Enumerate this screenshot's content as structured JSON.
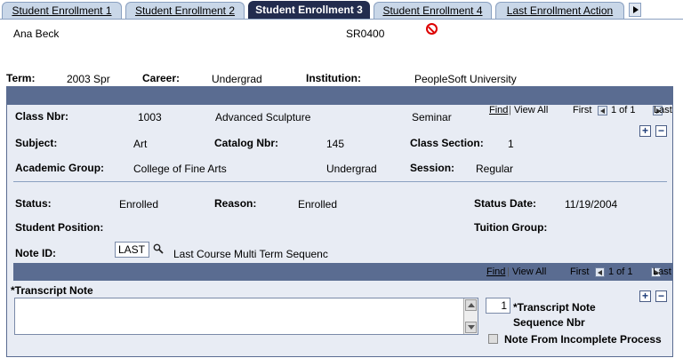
{
  "tabs": [
    {
      "label": "Student Enrollment 1",
      "active": false
    },
    {
      "label": "Student Enrollment 2",
      "active": false
    },
    {
      "label": "Student Enrollment 3",
      "active": true
    },
    {
      "label": "Student Enrollment 4",
      "active": false
    },
    {
      "label": "Last Enrollment Action",
      "active": false
    }
  ],
  "header": {
    "student_name": "Ana Beck",
    "student_id": "SR0400",
    "term_label": "Term:",
    "term_value": "2003 Spr",
    "career_label": "Career:",
    "career_value": "Undergrad",
    "institution_label": "Institution:",
    "institution_value": "PeopleSoft University"
  },
  "outer_nav": {
    "find": "Find",
    "sep": "|",
    "view_all": "View All",
    "first": "First",
    "position": "1 of 1",
    "last": "Last"
  },
  "class": {
    "class_nbr_label": "Class Nbr:",
    "class_nbr_value": "1003",
    "class_title": "Advanced Sculpture",
    "component": "Seminar",
    "subject_label": "Subject:",
    "subject_value": "Art",
    "catalog_label": "Catalog Nbr:",
    "catalog_value": "145",
    "section_label": "Class Section:",
    "section_value": "1",
    "acad_group_label": "Academic Group:",
    "acad_group_value": "College of Fine Arts",
    "acad_career": "Undergrad",
    "session_label": "Session:",
    "session_value": "Regular"
  },
  "status": {
    "status_label": "Status:",
    "status_value": "Enrolled",
    "reason_label": "Reason:",
    "reason_value": "Enrolled",
    "status_date_label": "Status Date:",
    "status_date_value": "11/19/2004",
    "position_label": "Student Position:",
    "tuition_label": "Tuition Group:",
    "note_id_label": "Note ID:",
    "note_id_value": "LAST",
    "note_desc": "Last Course Multi Term Sequenc"
  },
  "inner_nav": {
    "find": "Find",
    "sep": "|",
    "view_all": "View All",
    "first": "First",
    "position": "1 of 1",
    "last": "Last"
  },
  "transcript": {
    "note_label": "*Transcript Note",
    "note_text": "",
    "seq_value": "1",
    "seq_label_1": "*Transcript Note",
    "seq_label_2": "Sequence Nbr",
    "incomplete_label": "Note From Incomplete Process",
    "incomplete_checked": false
  },
  "buttons": {
    "add": "+",
    "remove": "−"
  }
}
